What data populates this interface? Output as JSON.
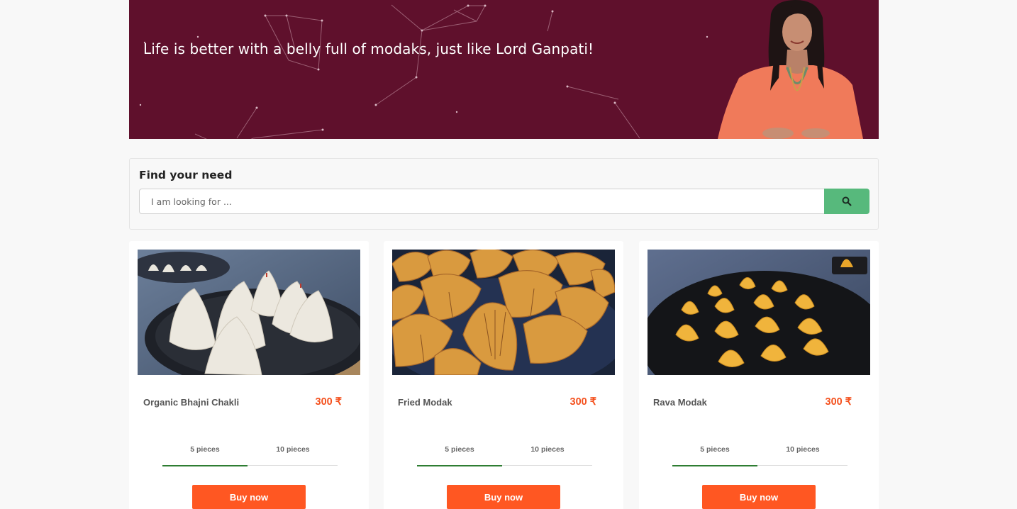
{
  "banner": {
    "tagline": "Life is better with a belly full of modaks, just like Lord Ganpati!",
    "background_color": "#5f102c"
  },
  "finder": {
    "title": "Find your need",
    "search_placeholder": "I am looking for ...",
    "search_button_icon": "search-icon",
    "search_button_color": "#57b97c"
  },
  "products": [
    {
      "name": "Organic Bhajni Chakli",
      "price": "300 ₹",
      "tabs": [
        "5 pieces",
        "10 pieces"
      ],
      "active_tab": 0,
      "buy_label": "Buy now",
      "image": "white-modak-photo"
    },
    {
      "name": "Fried Modak",
      "price": "300 ₹",
      "tabs": [
        "5 pieces",
        "10 pieces"
      ],
      "active_tab": 0,
      "buy_label": "Buy now",
      "image": "fried-modak-photo"
    },
    {
      "name": "Rava Modak",
      "price": "300 ₹",
      "tabs": [
        "5 pieces",
        "10 pieces"
      ],
      "active_tab": 0,
      "buy_label": "Buy now",
      "image": "rava-modak-photo"
    }
  ],
  "colors": {
    "accent": "#ff5722",
    "price": "#f4511e",
    "tab_active": "#2e7d32"
  }
}
